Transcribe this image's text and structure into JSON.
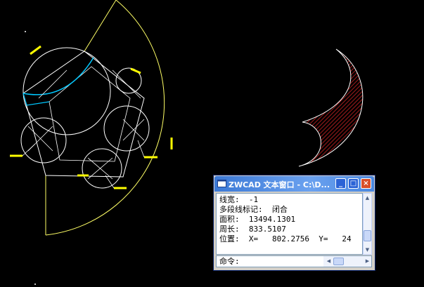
{
  "window": {
    "title": "ZWCAD 文本窗口 - C:\\D...",
    "controls": {
      "minimize": "_",
      "maximize": "□",
      "close": "×"
    }
  },
  "output_lines": [
    "线宽:  -1",
    "多段线标记:  闭合",
    "面积:  13494.1301",
    "周长:  833.5107",
    "位置:  X=   802.2756  Y=   24"
  ],
  "command": {
    "label": "命令:"
  },
  "colors": {
    "background": "#000000",
    "geometry": "#ffffff",
    "construction": "#ffff66",
    "grips": "#ffff00",
    "selected_arc": "#00c8ff",
    "hatch": "#cc2222"
  },
  "icons": {
    "app": "zwcad-app-icon",
    "scroll_up": "scroll-up-arrow-icon",
    "scroll_down": "scroll-down-arrow-icon",
    "scroll_left": "scroll-left-arrow-icon",
    "scroll_right": "scroll-right-arrow-icon"
  }
}
